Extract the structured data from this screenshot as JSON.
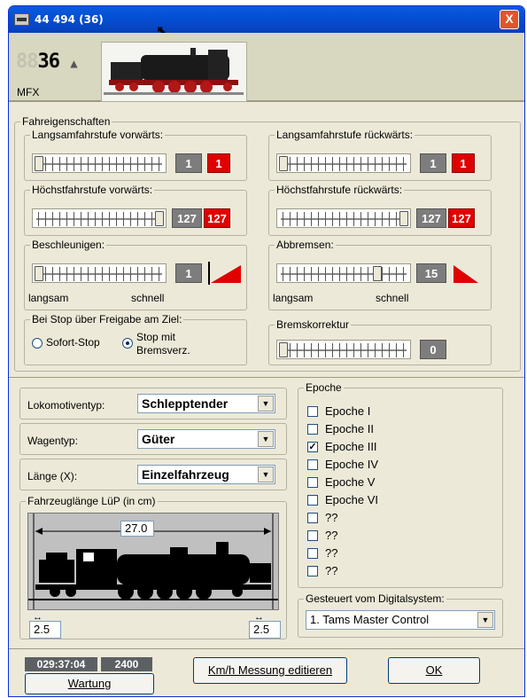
{
  "window": {
    "title": "44 494   (36)",
    "close_glyph": "X"
  },
  "header": {
    "address_dim": "88",
    "address": "36",
    "arrow_glyph": "▲",
    "protocol": "MFX"
  },
  "fahreigenschaften": {
    "title": "Fahreigenschaften",
    "langsam_vor": {
      "label": "Langsamfahrstufe vorwärts:",
      "value": "1",
      "value_red": "1",
      "level": 0.0
    },
    "langsam_rueck": {
      "label": "Langsamfahrstufe rückwärts:",
      "value": "1",
      "value_red": "1",
      "level": 0.0
    },
    "hoechst_vor": {
      "label": "Höchstfahrstufe vorwärts:",
      "value": "127",
      "value_red": "127",
      "level": 1.0
    },
    "hoechst_rueck": {
      "label": "Höchstfahrstufe rückwärts:",
      "value": "127",
      "value_red": "127",
      "level": 1.0
    },
    "beschleunigen": {
      "label": "Beschleunigen:",
      "value": "1",
      "left": "langsam",
      "right": "schnell",
      "level": 0.0
    },
    "abbremsen": {
      "label": "Abbremsen:",
      "value": "15",
      "left": "langsam",
      "right": "schnell",
      "level": 0.78
    },
    "stop": {
      "label": "Bei Stop über Freigabe am Ziel:",
      "option1": "Sofort-Stop",
      "option2_line1": "Stop mit",
      "option2_line2": "Bremsverz.",
      "selected": "option2"
    },
    "bremskorrektur": {
      "label": "Bremskorrektur",
      "value": "0",
      "level": 0.0
    }
  },
  "loco": {
    "typ_label": "Lokomotiventyp:",
    "typ_value": "Schlepptender",
    "wagen_label": "Wagentyp:",
    "wagen_value": "Güter",
    "laenge_label": "Länge (X):",
    "laenge_value": "Einzelfahrzeug",
    "fzl_title": "Fahrzeuglänge LüP (in cm)",
    "fzl_total": "27.0",
    "fzl_left": "2.5",
    "fzl_right": "2.5"
  },
  "epoche": {
    "title": "Epoche",
    "items": [
      {
        "label": "Epoche I",
        "checked": false
      },
      {
        "label": "Epoche II",
        "checked": false
      },
      {
        "label": "Epoche III",
        "checked": true
      },
      {
        "label": "Epoche IV",
        "checked": false
      },
      {
        "label": "Epoche V",
        "checked": false
      },
      {
        "label": "Epoche VI",
        "checked": false
      },
      {
        "label": "??",
        "checked": false
      },
      {
        "label": "??",
        "checked": false
      },
      {
        "label": "??",
        "checked": false
      },
      {
        "label": "??",
        "checked": false
      }
    ],
    "system_label": "Gesteuert vom Digitalsystem:",
    "system_value": "1. Tams Master Control"
  },
  "footer": {
    "time": "029:37:04",
    "count": "2400",
    "wartung": "Wartung",
    "kmh": "Km/h Messung editieren",
    "ok": "OK"
  },
  "colors": {
    "accent_red": "#e00000",
    "value_grey": "#7d7d7d"
  }
}
